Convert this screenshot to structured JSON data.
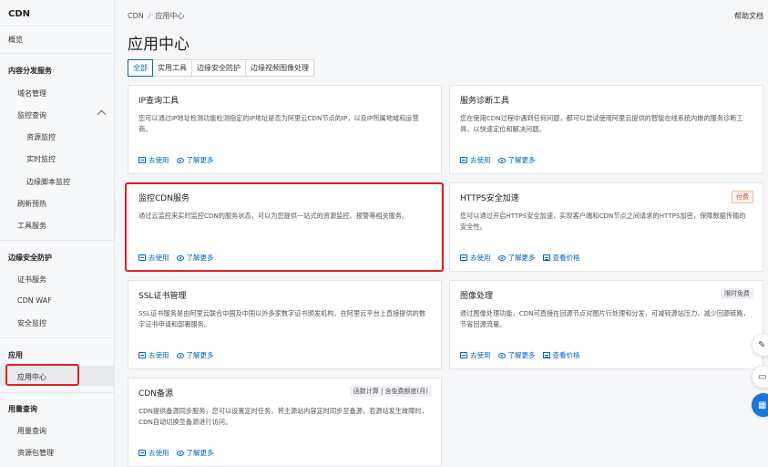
{
  "sidebar": {
    "title": "CDN",
    "overview": "概览",
    "groups": {
      "distribution": "内容分发服务",
      "domain": "域名管理",
      "monitor": "监控查询",
      "resource_monitor": "资源监控",
      "realtime_monitor": "实时监控",
      "edge_script_monitor": "边缘脚本监控",
      "refresh": "刷新预热",
      "tools": "工具服务",
      "edge_security": "边缘安全防护",
      "cert": "证书服务",
      "waf": "CDN WAF",
      "security_monitor": "安全监控",
      "apps": "应用",
      "app_center": "应用中心",
      "usage": "用量查询",
      "usage_query": "用量查询",
      "package": "资源包管理"
    }
  },
  "header": {
    "breadcrumb_root": "CDN",
    "breadcrumb_sep": "/",
    "breadcrumb_current": "应用中心",
    "help": "帮助文档",
    "title": "应用中心"
  },
  "tabs": [
    "全部",
    "实用工具",
    "边缘安全防护",
    "边缘视频图像处理"
  ],
  "actions": {
    "use": "去使用",
    "learn": "了解更多",
    "price": "查看价格"
  },
  "cards": {
    "ip": {
      "title": "IP查询工具",
      "desc": "您可以通过IP地址检测功能检测指定的IP地址是否为阿里云CDN节点的IP，以及IP所属地域和运营商。"
    },
    "diag": {
      "title": "服务诊断工具",
      "desc": "您在使用CDN过程中遇到任何问题，都可以尝试使用阿里云提供的智能在线系统内嵌的服务诊断工具，以快速定位和解决问题。"
    },
    "monitor": {
      "title": "监控CDN服务",
      "desc": "通过云监控来实时监控CDN的服务状态，可以为您提供一站式的资源监控、报警等相关服务。"
    },
    "https": {
      "title": "HTTPS安全加速",
      "badge": "付费",
      "desc": "您可以通过开启HTTPS安全加速，实现客户端和CDN节点之间请求的HTTPS加密，保障数据传输的安全性。"
    },
    "ssl": {
      "title": "SSL证书管理",
      "desc": "SSL证书服务是由阿里云联合中国及中国以外多家数字证书颁发机构，在阿里云平台上直接提供的数字证书申请和部署服务。"
    },
    "image": {
      "title": "图像处理",
      "badge": "限时免费",
      "desc": "通过图像处理功能，CDN可直接在回源节点对图片行处理和分发，可减轻源站压力、减少回源链路，节省回源流量。"
    },
    "backup": {
      "title": "CDN备源",
      "badge": "函数计算 | 含免费额度(月)",
      "desc": "CDN提供备源同步服务，您可以设置定时任务，将主源站内容定时同步至备源，若源站发生故障时，CDN自动切换至备源进行访问。"
    }
  }
}
